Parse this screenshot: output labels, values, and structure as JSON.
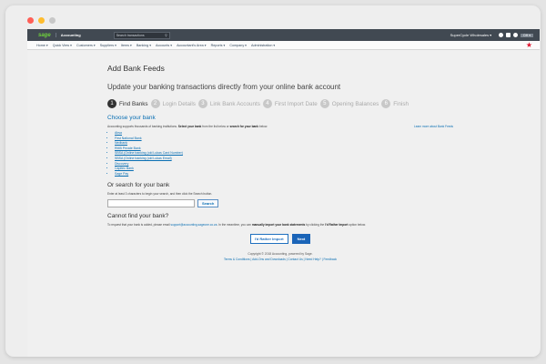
{
  "window": {
    "dots": [
      "#ff5f57",
      "#febc2e",
      "#c8c8c8"
    ]
  },
  "topbar": {
    "logo": "sage",
    "product": "Accounting",
    "search_placeholder": "Search transactions",
    "company": "SuperCycle Wholesales ▾",
    "avatar": "DH ▾"
  },
  "menu": {
    "items": [
      "Home ▾",
      "Quick View ▾",
      "Customers ▾",
      "Suppliers ▾",
      "Items ▾",
      "Banking ▾",
      "Accounts ▾",
      "Accountant's Area ▾",
      "Reports ▾",
      "Company ▾",
      "Administration ▾"
    ]
  },
  "page": {
    "title": "Add Bank Feeds",
    "subtitle": "Update your banking transactions directly from your online bank account"
  },
  "steps": [
    {
      "num": "1",
      "label": "Find Banks"
    },
    {
      "num": "2",
      "label": "Login Details"
    },
    {
      "num": "3",
      "label": "Link Bank Accounts"
    },
    {
      "num": "4",
      "label": "First Import Date"
    },
    {
      "num": "5",
      "label": "Opening Balances"
    },
    {
      "num": "6",
      "label": "Finish"
    }
  ],
  "choose": {
    "title": "Choose your bank",
    "intro_a": "Accounting supports thousands of banking institutions. ",
    "intro_b": "Select your bank",
    "intro_c": " from the list below or ",
    "intro_d": "search for your bank",
    "intro_e": " below.",
    "learn_more": "Learn more about Bank Feeds",
    "banks": [
      "Absa",
      "First National Bank",
      "Nedbank",
      "RMB Private Bank",
      "SBSA (Online banking (old Lukas Card Number)",
      "SBSA (Online banking (old Lukas Email)",
      "Discovery",
      "Capitec Bank",
      "Sage Pay"
    ]
  },
  "search": {
    "title": "Or search for your bank",
    "hint": "Enter at least 3 characters to begin your search, and then click the Search button.",
    "button": "Search"
  },
  "cannot": {
    "title": "Cannot find your bank?",
    "text_a": "To request that your bank is added, please email ",
    "email": "support@accounting.sageone.co.za",
    "text_b": ". In the meantime, you can ",
    "text_c": "manually import your bank statements",
    "text_d": " by clicking the ",
    "text_e": "I'd Rather Import",
    "text_f": " option below."
  },
  "actions": {
    "rather_import": "I'd Rather Import",
    "next": "Next"
  },
  "footer": {
    "copyright": "Copyright © 2018 Accounting, powered by Sage.",
    "links": "Terms & Conditions | Add-Ons and Downloads | Contact Us | Need Help? | Feedback"
  }
}
